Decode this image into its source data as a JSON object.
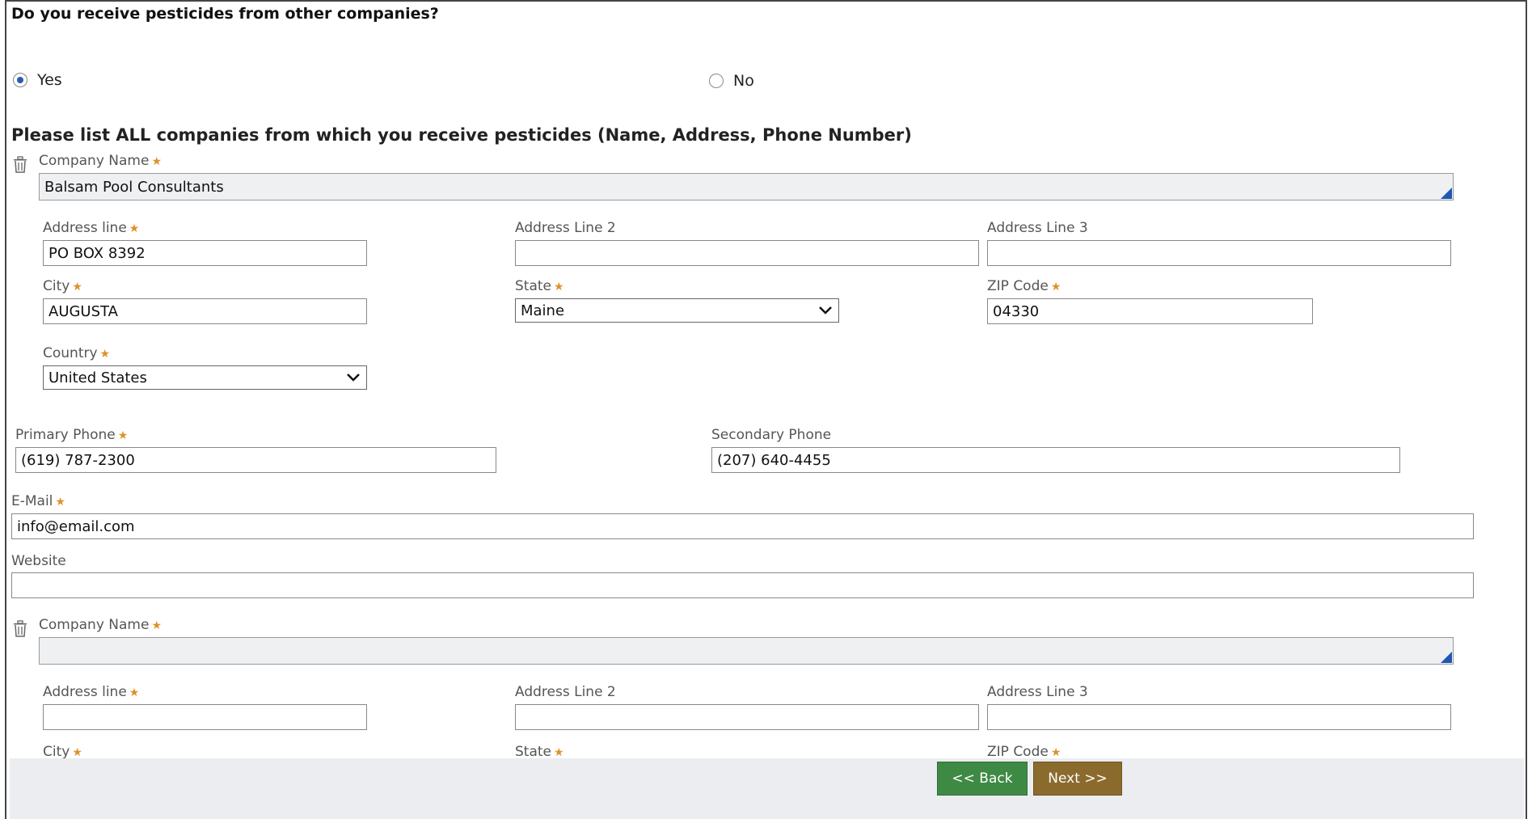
{
  "question": {
    "title": "Do you receive pesticides from other companies?",
    "options": [
      {
        "label": "Yes",
        "selected": true
      },
      {
        "label": "No",
        "selected": false
      }
    ]
  },
  "section_title": "Please list ALL companies from which you receive pesticides (Name, Address, Phone Number)",
  "labels": {
    "company_name": "Company Name",
    "address_line": "Address line",
    "address_line_2": "Address Line 2",
    "address_line_3": "Address Line 3",
    "city": "City",
    "state": "State",
    "zip": "ZIP Code",
    "country": "Country",
    "primary_phone": "Primary Phone",
    "secondary_phone": "Secondary Phone",
    "email": "E-Mail",
    "website": "Website",
    "required_mark": "★"
  },
  "companies": [
    {
      "company_name": "Balsam Pool Consultants",
      "address_line": "PO BOX 8392",
      "address_line_2": "",
      "address_line_3": "",
      "city": "AUGUSTA",
      "state": "Maine",
      "zip": "04330",
      "country": "United States",
      "primary_phone": "(619) 787-2300",
      "secondary_phone": "(207) 640-4455",
      "email": "info@email.com",
      "website": ""
    },
    {
      "company_name": "",
      "address_line": "",
      "address_line_2": "",
      "address_line_3": ""
    }
  ],
  "buttons": {
    "back": "<< Back",
    "next": "Next >>"
  },
  "colors": {
    "back_button": "#3e8a45",
    "next_button": "#8b6a2e",
    "required": "#e0902a",
    "resize_handle": "#1f57b5"
  }
}
